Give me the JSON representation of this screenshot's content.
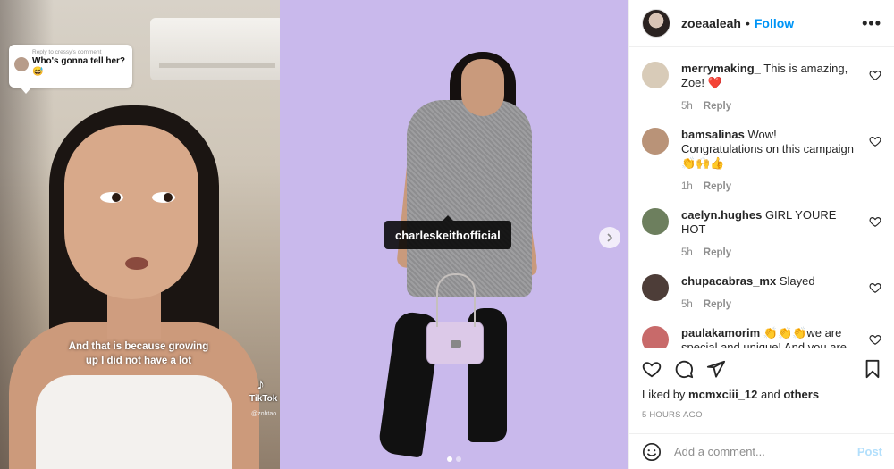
{
  "video": {
    "reply_meta": "Reply to cressy's comment",
    "reply_text": "Who's gonna tell her?",
    "reply_emoji": "😅",
    "caption": "And that is because growing up I did not have a lot",
    "tiktok_brand": "TikTok",
    "tiktok_user": "@zohtao"
  },
  "photo": {
    "tag": "charleskeithofficial",
    "next_icon": "chevron-right-icon",
    "carousel_dots": 2,
    "active_dot": 0,
    "colors": {
      "backdrop": "#c9b9ec"
    }
  },
  "post": {
    "username": "zoeaaleah",
    "separator": "•",
    "follow_label": "Follow",
    "more_label": "•••"
  },
  "comments": [
    {
      "user": "merrymaking_",
      "text": "This is amazing, Zoe! ❤️",
      "time": "5h",
      "reply": "Reply",
      "avatar_color": "#d8cbb8"
    },
    {
      "user": "bamsalinas",
      "text": "Wow! Congratulations on this campaign 👏🙌👍",
      "time": "1h",
      "reply": "Reply",
      "avatar_color": "#b99378"
    },
    {
      "user": "caelyn.hughes",
      "text": "GIRL YOURE HOT",
      "time": "5h",
      "reply": "Reply",
      "avatar_color": "#6d7f5e"
    },
    {
      "user": "chupacabras_mx",
      "text": "Slayed",
      "time": "5h",
      "reply": "Reply",
      "avatar_color": "#4d3d38"
    },
    {
      "user": "paulakamorim",
      "text": "👏👏👏we are special and unique! And you are amazing!💋❤️",
      "time": "",
      "reply": "",
      "avatar_color": "#c86a6a"
    }
  ],
  "actions": {
    "liked_by_prefix": "Liked by",
    "liked_by_user": "mcmxciii_12",
    "liked_by_and": "and",
    "liked_by_others": "others",
    "time_ago": "5 HOURS AGO"
  },
  "composer": {
    "placeholder": "Add a comment...",
    "post_label": "Post"
  },
  "colors": {
    "accent": "#0095f6",
    "post_disabled": "#b2dffc"
  }
}
